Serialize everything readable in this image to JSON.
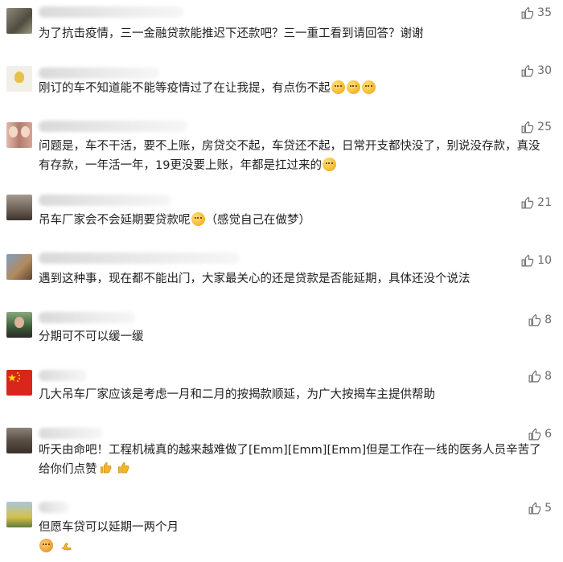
{
  "comments": [
    {
      "likes": "35",
      "text": "为了抗击疫情，三一金融贷款能推迟下还款吧？三一重工看到请回答？谢谢",
      "avatar_color": "#6d6a5a"
    },
    {
      "likes": "30",
      "text": "刚订的车不知道能不能等疫情过了在让我提，有点伤不起",
      "avatar_color": "#e9e3d6"
    },
    {
      "likes": "25",
      "text": "问题是，车不干活，要不上账，房贷交不起，车贷还不起，日常开支都快没了，别说没存款，真没有存款，一年活一年，19更没要上账，年都是扛过来的",
      "avatar_color": "#c98f86"
    },
    {
      "likes": "21",
      "text": "吊车厂家会不会延期要贷款呢",
      "text_suffix": "（感觉自己在做梦）",
      "avatar_color": "#7c6f5f"
    },
    {
      "likes": "10",
      "text": "遇到这种事，现在都不能出门，大家最关心的还是贷款是否能延期，具体还没个说法",
      "avatar_color": "#8a6a4e"
    },
    {
      "likes": "8",
      "text": "分期可不可以缓一缓",
      "avatar_color": "#3e5a3c"
    },
    {
      "likes": "8",
      "text": "几大吊车厂家应该是考虑一月和二月的按揭款顺延，为广大按揭车主提供帮助",
      "avatar_color": "#d8261c"
    },
    {
      "likes": "6",
      "text": "听天由命吧！工程机械真的越来越难做了[Emm][Emm][Emm]但是工作在一线的医务人员辛苦了给你们点赞",
      "avatar_color": "#6a6055"
    },
    {
      "likes": "5",
      "text": "但愿车贷可以延期一两个月",
      "avatar_color": "#8fb0c9"
    }
  ],
  "icons": {
    "like": "thumbs-up-outline-icon",
    "emoji": "smiley-face-icon"
  }
}
